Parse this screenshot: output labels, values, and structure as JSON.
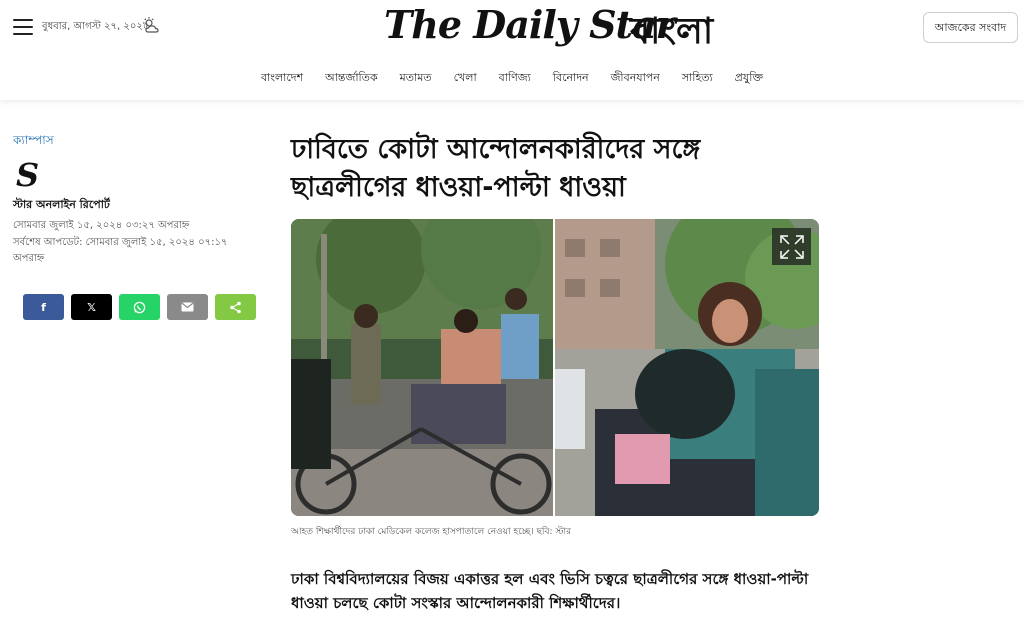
{
  "header": {
    "date": "বুধবার, আগস্ট ২৭, ২০২৫",
    "weather_icon": "partly-cloudy-icon",
    "logo_en": "The Daily Star",
    "logo_bn": "বাংলা",
    "today_news_label": "আজকের সংবাদ"
  },
  "nav": {
    "items": [
      {
        "label": "বাংলাদেশ"
      },
      {
        "label": "আন্তর্জাতিক"
      },
      {
        "label": "মতামত"
      },
      {
        "label": "খেলা"
      },
      {
        "label": "বাণিজ্য"
      },
      {
        "label": "বিনোদন"
      },
      {
        "label": "জীবনযাপন"
      },
      {
        "label": "সাহিত্য"
      },
      {
        "label": "প্রযুক্তি"
      }
    ]
  },
  "article": {
    "section": "ক্যাম্পাস",
    "author_logo": "S",
    "author": "স্টার অনলাইন রিপোর্ট",
    "published": "সোমবার জুলাই ১৫, ২০২৪ ০৩:২৭ অপরাহ্ন",
    "updated": "সর্বশেষ আপডেট: সোমবার জুলাই ১৫, ২০২৪ ০৭:১৭ অপরাহ্ন",
    "headline": "ঢাবিতে কোটা আন্দোলনকারীদের সঙ্গে ছাত্রলীগের ধাওয়া-পাল্টা ধাওয়া",
    "caption": "আহত শিক্ষার্থীদের ঢাকা মেডিকেল কলেজ হাসপাতালে নেওয়া হচ্ছে। ছবি: স্টার",
    "lead": "ঢাকা বিশ্ববিদ্যালয়ের বিজয় একাত্তর হল এবং ভিসি চত্বরে ছাত্রলীগের সঙ্গে ধাওয়া-পাল্টা ধাওয়া চলছে কোটা সংস্কার আন্দোলনকারী শিক্ষার্থীদের।"
  },
  "share": {
    "buttons": [
      {
        "label": "f",
        "icon": "facebook-icon",
        "color": "#3b5a99"
      },
      {
        "label": "𝕏",
        "icon": "x-icon",
        "color": "#000000"
      },
      {
        "label": "",
        "icon": "whatsapp-icon",
        "color": "#25d366"
      },
      {
        "label": "",
        "icon": "mail-icon",
        "color": "#8a8a8a"
      },
      {
        "label": "",
        "icon": "share-icon",
        "color": "#83c944"
      }
    ]
  },
  "colors": {
    "section_link": "#2474b5",
    "text": "#111111"
  }
}
